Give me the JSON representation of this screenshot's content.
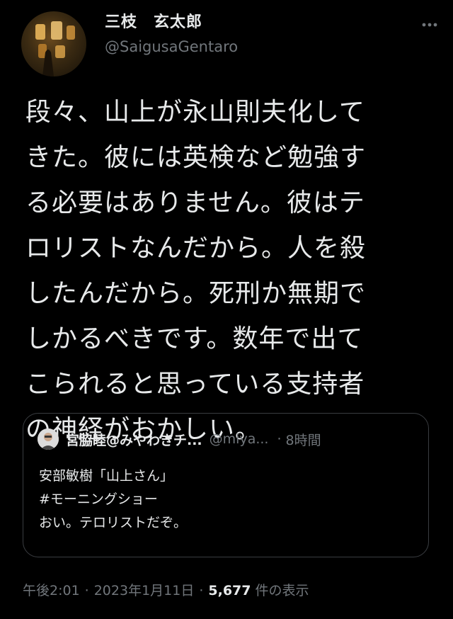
{
  "author": {
    "display_name": "三枝　玄太郎",
    "handle": "@SaigusaGentaro"
  },
  "tweet": {
    "text": "段々、山上が永山則夫化して\nきた。彼には英検など勉強す\nる必要はありません。彼はテ\nロリストなんだから。人を殺\nしたんだから。死刑か無期で\nしかるべきです。数年で出て\nこられると思っている支持者\nの神経がおかしい。"
  },
  "quote": {
    "author_name": "宮脇睦@みやわきチ...",
    "author_handle": "@miya...",
    "separator": "·",
    "time": "8時間",
    "text": "安部敏樹「山上さん」\n#モーニングショー\nおい。テロリストだぞ。"
  },
  "meta": {
    "time": "午後2:01",
    "separator": "·",
    "date": "2023年1月11日",
    "views_count": "5,677",
    "views_label": "件の表示"
  },
  "icons": {
    "more": "more-horizontal-icon"
  },
  "colors": {
    "background": "#000000",
    "text_primary": "#e7e9ea",
    "text_secondary": "#71767b",
    "quote_border": "#3a3d41"
  }
}
